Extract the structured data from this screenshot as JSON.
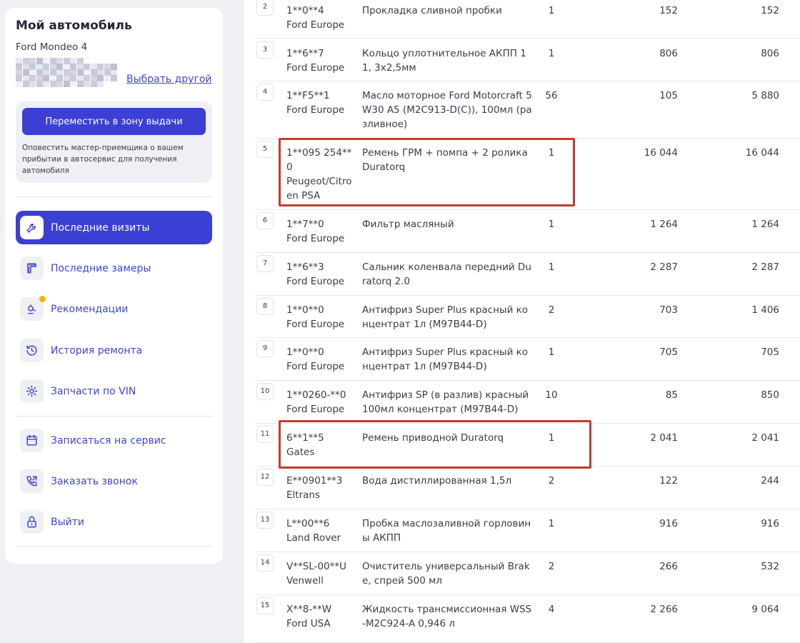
{
  "sidebar": {
    "title": "Мой автомобиль",
    "model": "Ford Mondeo 4",
    "choose_other": "Выбрать другой",
    "move_button": "Переместить в зону выдачи",
    "notice": "Оповестить мастер-приемщика о вашем прибытии в автосервис для получения автомобиля",
    "nav": [
      {
        "label": "Последние визиты",
        "icon": "wrench-icon",
        "active": true
      },
      {
        "label": "Последние замеры",
        "icon": "ruler-icon"
      },
      {
        "label": "Рекомендации",
        "icon": "recommendations-icon",
        "badge_color": "#f5b400"
      },
      {
        "label": "История ремонта",
        "icon": "history-icon"
      },
      {
        "label": "Запчасти по VIN",
        "icon": "gear-icon"
      },
      {
        "label": "Записаться на сервис",
        "icon": "calendar-icon"
      },
      {
        "label": "Заказать звонок",
        "icon": "phone-icon"
      },
      {
        "label": "Выйти",
        "icon": "lock-icon"
      }
    ]
  },
  "parts": [
    {
      "n": "2",
      "code": "1**0**4",
      "brand": "Ford Europe",
      "name": "Прокладка сливной пробки",
      "qty": "1",
      "price": "152",
      "total": "152"
    },
    {
      "n": "3",
      "code": "1**6**7",
      "brand": "Ford Europe",
      "name": "Кольцо уплотнительное АКПП 11, 3x2,5мм",
      "qty": "1",
      "price": "806",
      "total": "806"
    },
    {
      "n": "4",
      "code": "1**F5**1",
      "brand": "Ford Europe",
      "name": "Масло моторное Ford Motorcraft 5W30 A5 (M2C913-D(C)), 100мл (разливное)",
      "qty": "56",
      "price": "105",
      "total": "5 880"
    },
    {
      "n": "5",
      "code": "1**095 254**0",
      "brand": "Peugeot/Citroen PSA",
      "name": "Ремень ГРМ + помпа + 2 ролика Duratorq",
      "qty": "1",
      "price": "16 044",
      "total": "16 044",
      "highlighted": true
    },
    {
      "n": "6",
      "code": "1**7**0",
      "brand": "Ford Europe",
      "name": "Фильтр масляный",
      "qty": "1",
      "price": "1 264",
      "total": "1 264"
    },
    {
      "n": "7",
      "code": "1**6**3",
      "brand": "Ford Europe",
      "name": "Сальник коленвала передний Duratorq 2.0",
      "qty": "1",
      "price": "2 287",
      "total": "2 287"
    },
    {
      "n": "8",
      "code": "1**0**0",
      "brand": "Ford Europe",
      "name": "Антифриз Super Plus красный концентрат 1л (M97B44-D)",
      "qty": "2",
      "price": "703",
      "total": "1 406"
    },
    {
      "n": "9",
      "code": "1**0**0",
      "brand": "Ford Europe",
      "name": "Антифриз Super Plus красный концентрат 1л (M97B44-D)",
      "qty": "1",
      "price": "705",
      "total": "705"
    },
    {
      "n": "10",
      "code": "1**0260-**0",
      "brand": "Ford Europe",
      "name": "Антифриз SP (в разлив) красный 100мл концентрат (M97B44-D)",
      "qty": "10",
      "price": "85",
      "total": "850"
    },
    {
      "n": "11",
      "code": "6**1**5",
      "brand": "Gates",
      "name": "Ремень приводной Duratorq",
      "qty": "1",
      "price": "2 041",
      "total": "2 041",
      "highlighted": true
    },
    {
      "n": "12",
      "code": "E**0901**3",
      "brand": "Eltrans",
      "name": "Вода дистиллированная 1,5л",
      "qty": "2",
      "price": "122",
      "total": "244"
    },
    {
      "n": "13",
      "code": "L**00**6",
      "brand": "Land Rover",
      "name": "Пробка маслозаливной горловины АКПП",
      "qty": "1",
      "price": "916",
      "total": "916"
    },
    {
      "n": "14",
      "code": "V**SL-00**U",
      "brand": "Venwell",
      "name": "Очиститель универсальный Brake, спрей 500 мл",
      "qty": "2",
      "price": "266",
      "total": "532"
    },
    {
      "n": "15",
      "code": "X**8-**W",
      "brand": "Ford USA",
      "name": "Жидкость трансмиссионная WSS-M2C924-A 0,946 л",
      "qty": "4",
      "price": "2 266",
      "total": "9 064"
    }
  ],
  "colors": {
    "accent": "#3b3fd3",
    "link": "#3b46cf",
    "highlight": "#c43b32",
    "badge": "#f5b400"
  }
}
